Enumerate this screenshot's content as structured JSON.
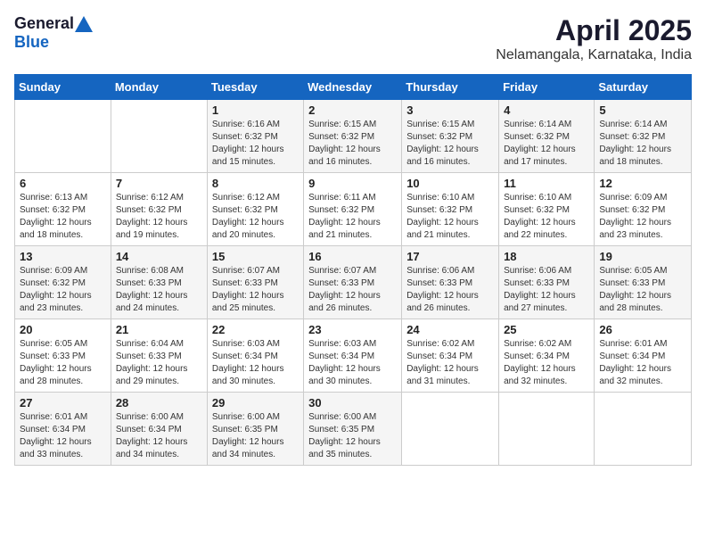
{
  "logo": {
    "general": "General",
    "blue": "Blue"
  },
  "header": {
    "month": "April 2025",
    "location": "Nelamangala, Karnataka, India"
  },
  "days_of_week": [
    "Sunday",
    "Monday",
    "Tuesday",
    "Wednesday",
    "Thursday",
    "Friday",
    "Saturday"
  ],
  "weeks": [
    [
      {
        "day": "",
        "info": ""
      },
      {
        "day": "",
        "info": ""
      },
      {
        "day": "1",
        "info": "Sunrise: 6:16 AM\nSunset: 6:32 PM\nDaylight: 12 hours and 15 minutes."
      },
      {
        "day": "2",
        "info": "Sunrise: 6:15 AM\nSunset: 6:32 PM\nDaylight: 12 hours and 16 minutes."
      },
      {
        "day": "3",
        "info": "Sunrise: 6:15 AM\nSunset: 6:32 PM\nDaylight: 12 hours and 16 minutes."
      },
      {
        "day": "4",
        "info": "Sunrise: 6:14 AM\nSunset: 6:32 PM\nDaylight: 12 hours and 17 minutes."
      },
      {
        "day": "5",
        "info": "Sunrise: 6:14 AM\nSunset: 6:32 PM\nDaylight: 12 hours and 18 minutes."
      }
    ],
    [
      {
        "day": "6",
        "info": "Sunrise: 6:13 AM\nSunset: 6:32 PM\nDaylight: 12 hours and 18 minutes."
      },
      {
        "day": "7",
        "info": "Sunrise: 6:12 AM\nSunset: 6:32 PM\nDaylight: 12 hours and 19 minutes."
      },
      {
        "day": "8",
        "info": "Sunrise: 6:12 AM\nSunset: 6:32 PM\nDaylight: 12 hours and 20 minutes."
      },
      {
        "day": "9",
        "info": "Sunrise: 6:11 AM\nSunset: 6:32 PM\nDaylight: 12 hours and 21 minutes."
      },
      {
        "day": "10",
        "info": "Sunrise: 6:10 AM\nSunset: 6:32 PM\nDaylight: 12 hours and 21 minutes."
      },
      {
        "day": "11",
        "info": "Sunrise: 6:10 AM\nSunset: 6:32 PM\nDaylight: 12 hours and 22 minutes."
      },
      {
        "day": "12",
        "info": "Sunrise: 6:09 AM\nSunset: 6:32 PM\nDaylight: 12 hours and 23 minutes."
      }
    ],
    [
      {
        "day": "13",
        "info": "Sunrise: 6:09 AM\nSunset: 6:32 PM\nDaylight: 12 hours and 23 minutes."
      },
      {
        "day": "14",
        "info": "Sunrise: 6:08 AM\nSunset: 6:33 PM\nDaylight: 12 hours and 24 minutes."
      },
      {
        "day": "15",
        "info": "Sunrise: 6:07 AM\nSunset: 6:33 PM\nDaylight: 12 hours and 25 minutes."
      },
      {
        "day": "16",
        "info": "Sunrise: 6:07 AM\nSunset: 6:33 PM\nDaylight: 12 hours and 26 minutes."
      },
      {
        "day": "17",
        "info": "Sunrise: 6:06 AM\nSunset: 6:33 PM\nDaylight: 12 hours and 26 minutes."
      },
      {
        "day": "18",
        "info": "Sunrise: 6:06 AM\nSunset: 6:33 PM\nDaylight: 12 hours and 27 minutes."
      },
      {
        "day": "19",
        "info": "Sunrise: 6:05 AM\nSunset: 6:33 PM\nDaylight: 12 hours and 28 minutes."
      }
    ],
    [
      {
        "day": "20",
        "info": "Sunrise: 6:05 AM\nSunset: 6:33 PM\nDaylight: 12 hours and 28 minutes."
      },
      {
        "day": "21",
        "info": "Sunrise: 6:04 AM\nSunset: 6:33 PM\nDaylight: 12 hours and 29 minutes."
      },
      {
        "day": "22",
        "info": "Sunrise: 6:03 AM\nSunset: 6:34 PM\nDaylight: 12 hours and 30 minutes."
      },
      {
        "day": "23",
        "info": "Sunrise: 6:03 AM\nSunset: 6:34 PM\nDaylight: 12 hours and 30 minutes."
      },
      {
        "day": "24",
        "info": "Sunrise: 6:02 AM\nSunset: 6:34 PM\nDaylight: 12 hours and 31 minutes."
      },
      {
        "day": "25",
        "info": "Sunrise: 6:02 AM\nSunset: 6:34 PM\nDaylight: 12 hours and 32 minutes."
      },
      {
        "day": "26",
        "info": "Sunrise: 6:01 AM\nSunset: 6:34 PM\nDaylight: 12 hours and 32 minutes."
      }
    ],
    [
      {
        "day": "27",
        "info": "Sunrise: 6:01 AM\nSunset: 6:34 PM\nDaylight: 12 hours and 33 minutes."
      },
      {
        "day": "28",
        "info": "Sunrise: 6:00 AM\nSunset: 6:34 PM\nDaylight: 12 hours and 34 minutes."
      },
      {
        "day": "29",
        "info": "Sunrise: 6:00 AM\nSunset: 6:35 PM\nDaylight: 12 hours and 34 minutes."
      },
      {
        "day": "30",
        "info": "Sunrise: 6:00 AM\nSunset: 6:35 PM\nDaylight: 12 hours and 35 minutes."
      },
      {
        "day": "",
        "info": ""
      },
      {
        "day": "",
        "info": ""
      },
      {
        "day": "",
        "info": ""
      }
    ]
  ]
}
